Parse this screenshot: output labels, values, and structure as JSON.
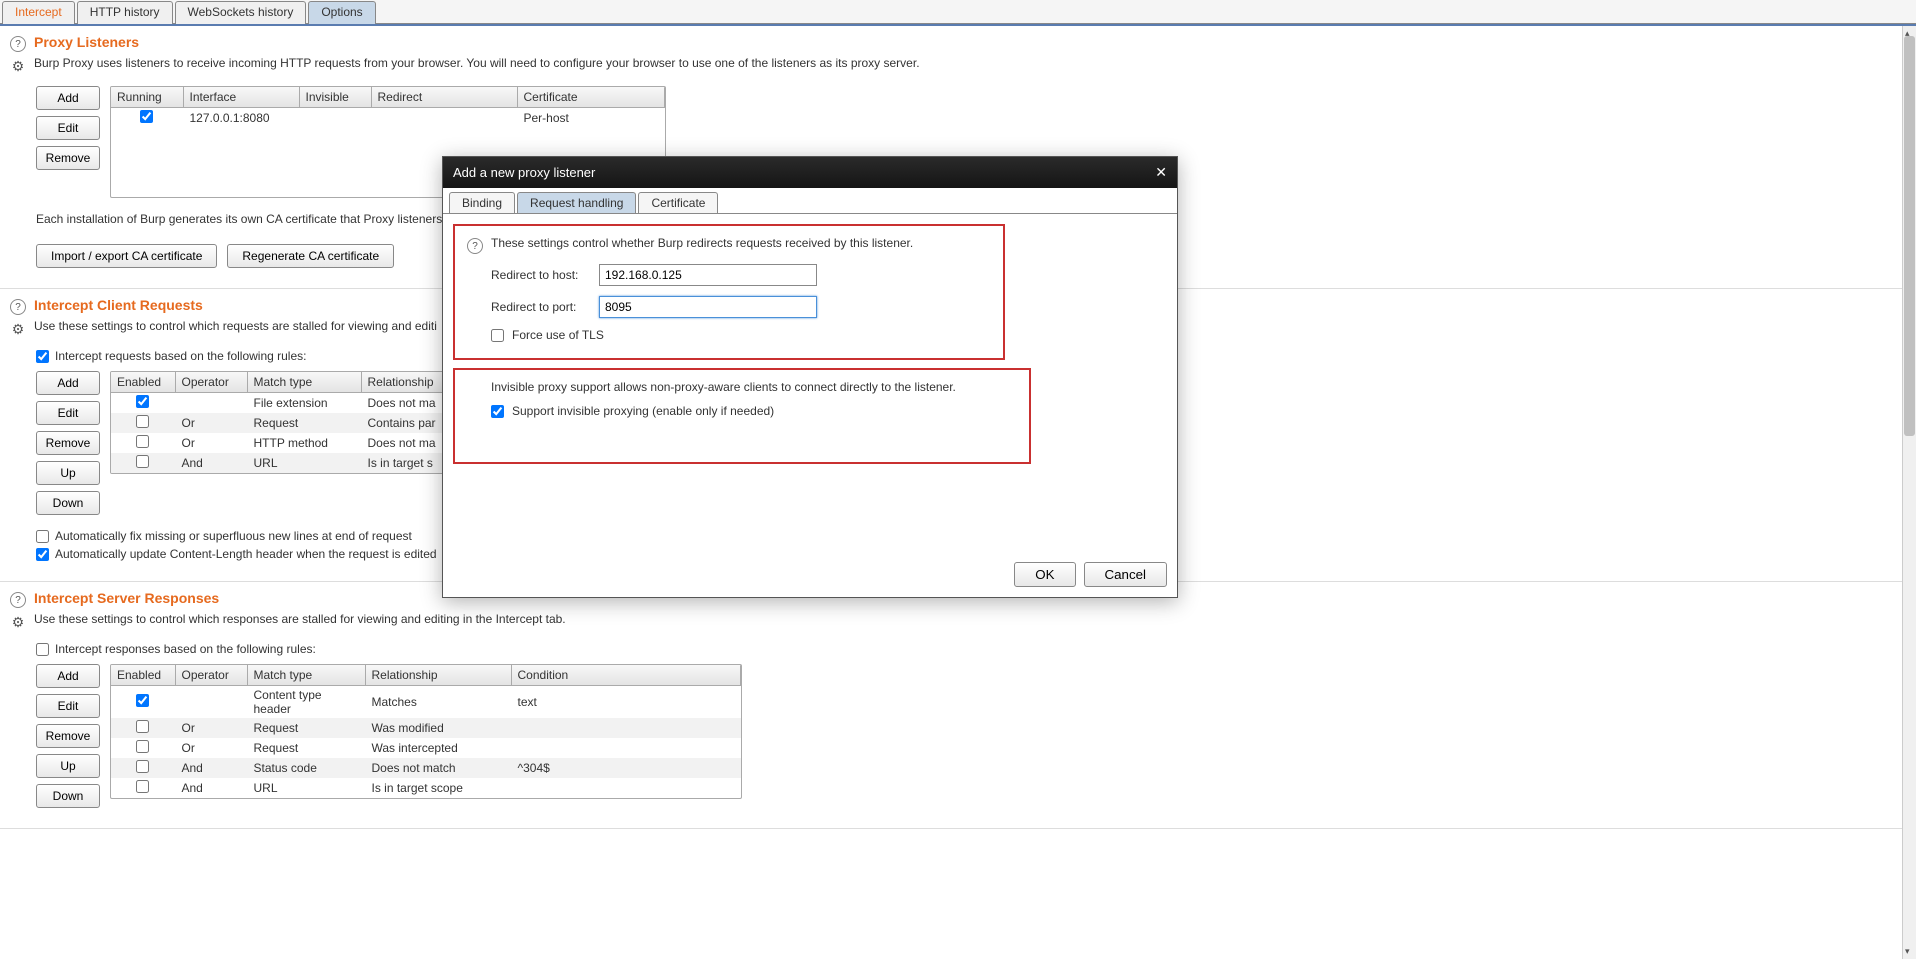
{
  "topTabs": {
    "intercept": "Intercept",
    "httpHistory": "HTTP history",
    "wsHistory": "WebSockets history",
    "options": "Options"
  },
  "proxyListeners": {
    "title": "Proxy Listeners",
    "desc": "Burp Proxy uses listeners to receive incoming HTTP requests from your browser. You will need to configure your browser to use one of the listeners as its proxy server.",
    "buttons": {
      "add": "Add",
      "edit": "Edit",
      "remove": "Remove"
    },
    "cols": {
      "running": "Running",
      "interface": "Interface",
      "invisible": "Invisible",
      "redirect": "Redirect",
      "certificate": "Certificate"
    },
    "rows": [
      {
        "running": true,
        "interface": "127.0.0.1:8080",
        "invisible": "",
        "redirect": "",
        "certificate": "Per-host"
      }
    ],
    "footer": "Each installation of Burp generates its own CA certificate that Proxy listeners",
    "importBtn": "Import / export CA certificate",
    "regenBtn": "Regenerate CA certificate"
  },
  "interceptClient": {
    "title": "Intercept Client Requests",
    "desc": "Use these settings to control which requests are stalled for viewing and editi",
    "ruleLabel": "Intercept requests based on the following rules:",
    "buttons": {
      "add": "Add",
      "edit": "Edit",
      "remove": "Remove",
      "up": "Up",
      "down": "Down"
    },
    "cols": {
      "enabled": "Enabled",
      "operator": "Operator",
      "matchType": "Match type",
      "relationship": "Relationship"
    },
    "rows": [
      {
        "enabled": true,
        "operator": "",
        "matchType": "File extension",
        "relationship": "Does not ma"
      },
      {
        "enabled": false,
        "operator": "Or",
        "matchType": "Request",
        "relationship": "Contains par"
      },
      {
        "enabled": false,
        "operator": "Or",
        "matchType": "HTTP method",
        "relationship": "Does not ma"
      },
      {
        "enabled": false,
        "operator": "And",
        "matchType": "URL",
        "relationship": "Is in target s"
      }
    ],
    "autoFix": "Automatically fix missing or superfluous new lines at end of request",
    "autoLen": "Automatically update Content-Length header when the request is edited"
  },
  "interceptServer": {
    "title": "Intercept Server Responses",
    "desc": "Use these settings to control which responses are stalled for viewing and editing in the Intercept tab.",
    "ruleLabel": "Intercept responses based on the following rules:",
    "buttons": {
      "add": "Add",
      "edit": "Edit",
      "remove": "Remove",
      "up": "Up",
      "down": "Down"
    },
    "cols": {
      "enabled": "Enabled",
      "operator": "Operator",
      "matchType": "Match type",
      "relationship": "Relationship",
      "condition": "Condition"
    },
    "rows": [
      {
        "enabled": true,
        "operator": "",
        "matchType": "Content type header",
        "relationship": "Matches",
        "condition": "text"
      },
      {
        "enabled": false,
        "operator": "Or",
        "matchType": "Request",
        "relationship": "Was modified",
        "condition": ""
      },
      {
        "enabled": false,
        "operator": "Or",
        "matchType": "Request",
        "relationship": "Was intercepted",
        "condition": ""
      },
      {
        "enabled": false,
        "operator": "And",
        "matchType": "Status code",
        "relationship": "Does not match",
        "condition": "^304$"
      },
      {
        "enabled": false,
        "operator": "And",
        "matchType": "URL",
        "relationship": "Is in target scope",
        "condition": ""
      }
    ]
  },
  "dialog": {
    "title": "Add a new proxy listener",
    "tabs": {
      "binding": "Binding",
      "reqHandling": "Request handling",
      "certificate": "Certificate"
    },
    "desc": "These settings control whether Burp redirects requests received by this listener.",
    "redirectHostLabel": "Redirect to host:",
    "redirectHost": "192.168.0.125",
    "redirectPortLabel": "Redirect to port:",
    "redirectPort": "8095",
    "forceTls": "Force use of TLS",
    "invisDesc": "Invisible proxy support allows non-proxy-aware clients to connect directly to the listener.",
    "supportInvis": "Support invisible proxying (enable only if needed)",
    "ok": "OK",
    "cancel": "Cancel"
  }
}
